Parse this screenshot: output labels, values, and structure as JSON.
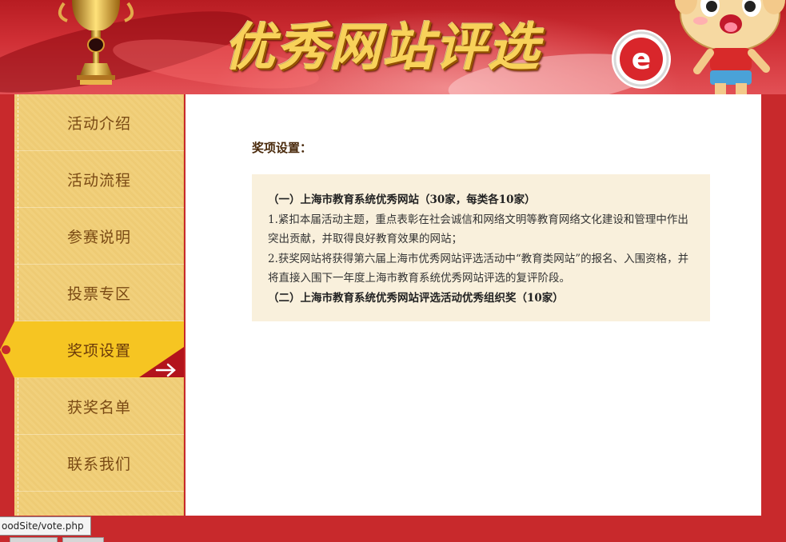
{
  "banner": {
    "title": "优秀网站评选",
    "logo_letter": "e"
  },
  "sidebar": {
    "items": [
      {
        "label": "活动介绍",
        "active": false
      },
      {
        "label": "活动流程",
        "active": false
      },
      {
        "label": "参赛说明",
        "active": false
      },
      {
        "label": "投票专区",
        "active": false
      },
      {
        "label": "奖项设置",
        "active": true
      },
      {
        "label": "获奖名单",
        "active": false
      },
      {
        "label": "联系我们",
        "active": false
      }
    ]
  },
  "main": {
    "section_title": "奖项设置：",
    "award1_heading": "（一）上海市教育系统优秀网站（30家，每类各10家）",
    "award1_item1": "1.紧扣本届活动主题，重点表彰在社会诚信和网络文明等教育网络文化建设和管理中作出突出贡献，并取得良好教育效果的网站；",
    "award1_item2": "2.获奖网站将获得第六届上海市优秀网站评选活动中“教育类网站”的报名、入围资格，并将直接入围下一年度上海市教育系统优秀网站评选的复评阶段。",
    "award2_heading": "（二）上海市教育系统优秀网站评选活动优秀组织奖（10家）"
  },
  "status": {
    "url": "oodSite/vote.php"
  },
  "colors": {
    "page_bg": "#c8292c",
    "sidebar_bg": "#f1d07c",
    "active_tab": "#f6c522",
    "info_box_bg": "#f9f0dc"
  }
}
